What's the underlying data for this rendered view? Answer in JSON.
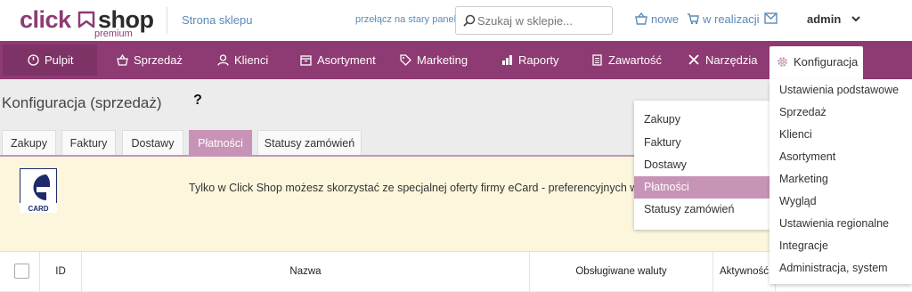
{
  "app": {
    "logo_click": "click",
    "logo_shop": "shop",
    "logo_premium": "premium",
    "brand_color": "#8e3b73",
    "accent_color": "#c793b6"
  },
  "topbar": {
    "store_link": "Strona sklepu",
    "old_panel_link": "przełącz na stary panel",
    "search_placeholder": "Szukaj w sklepie...",
    "new_label": "nowe",
    "in_progress_label": "w realizacji",
    "user_label": "admin"
  },
  "nav": {
    "items": [
      {
        "label": "Pulpit",
        "icon": "dashboard-icon"
      },
      {
        "label": "Sprzedaż",
        "icon": "basket-icon"
      },
      {
        "label": "Klienci",
        "icon": "user-icon"
      },
      {
        "label": "Asortyment",
        "icon": "box-icon"
      },
      {
        "label": "Marketing",
        "icon": "tag-icon"
      },
      {
        "label": "Raporty",
        "icon": "chart-icon"
      },
      {
        "label": "Zawartość",
        "icon": "document-icon"
      },
      {
        "label": "Narzędzia",
        "icon": "tools-icon"
      },
      {
        "label": "Konfiguracja",
        "icon": "gear-icon"
      }
    ]
  },
  "page": {
    "title": "Konfiguracja (sprzedaż)",
    "help": "?"
  },
  "tabs": [
    "Zakupy",
    "Faktury",
    "Dostawy",
    "Płatności",
    "Statusy zamówień"
  ],
  "banner": {
    "logo_text": "CARD",
    "text": "Tylko w Click Shop możesz skorzystać ze specjalnej oferty firmy eCard - preferencyjnych warunków"
  },
  "table": {
    "headers": [
      "ID",
      "Nazwa",
      "Obsługiwane waluty",
      "Aktywność"
    ]
  },
  "submenu": {
    "items": [
      "Zakupy",
      "Faktury",
      "Dostawy",
      "Płatności",
      "Statusy zamówień"
    ],
    "active": "Płatności"
  },
  "config_menu": {
    "items": [
      "Ustawienia podstawowe",
      "Sprzedaż",
      "Klienci",
      "Asortyment",
      "Marketing",
      "Wygląd",
      "Ustawienia regionalne",
      "Integracje",
      "Administracja, system"
    ]
  }
}
